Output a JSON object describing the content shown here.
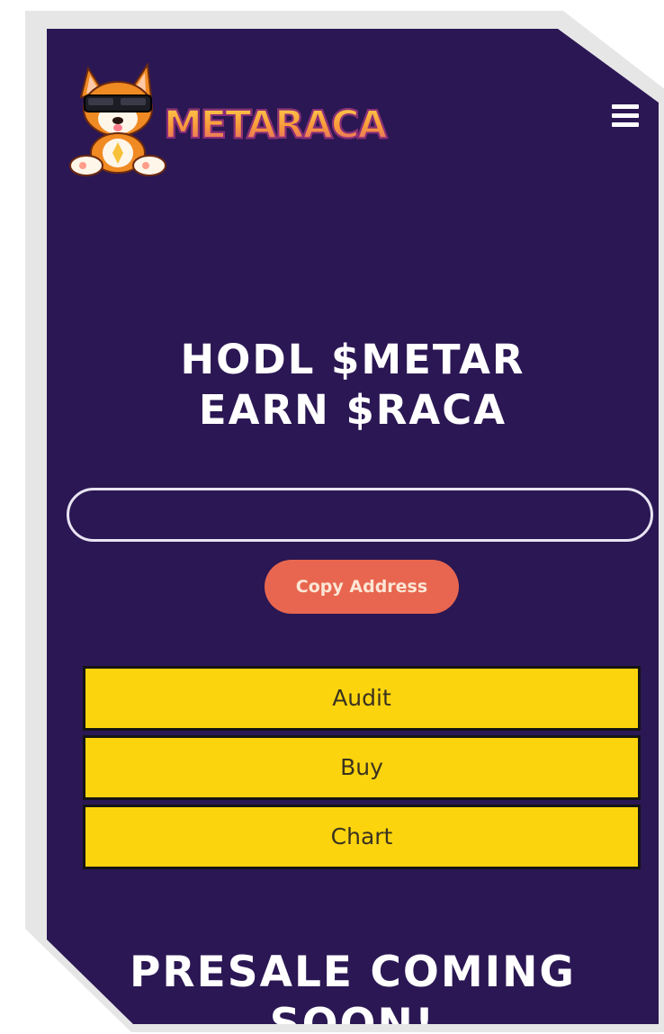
{
  "brand": {
    "name": "METARACA",
    "logo_icon": "corgi-mascot-vr-goggles",
    "colors": {
      "background": "#2b1754",
      "accent_orange": "#f7a23a",
      "copy_button": "#e8664f",
      "action_button": "#fcd40e"
    }
  },
  "header": {
    "menu_icon": "hamburger-menu-icon"
  },
  "hero": {
    "line1": "HODL $METAR",
    "line2": "EARN $RACA"
  },
  "contract": {
    "address_value": "",
    "copy_label": "Copy Address"
  },
  "actions": [
    {
      "label": "Audit"
    },
    {
      "label": "Buy"
    },
    {
      "label": "Chart"
    }
  ],
  "presale": {
    "text": "PRESALE COMING SOON!"
  }
}
